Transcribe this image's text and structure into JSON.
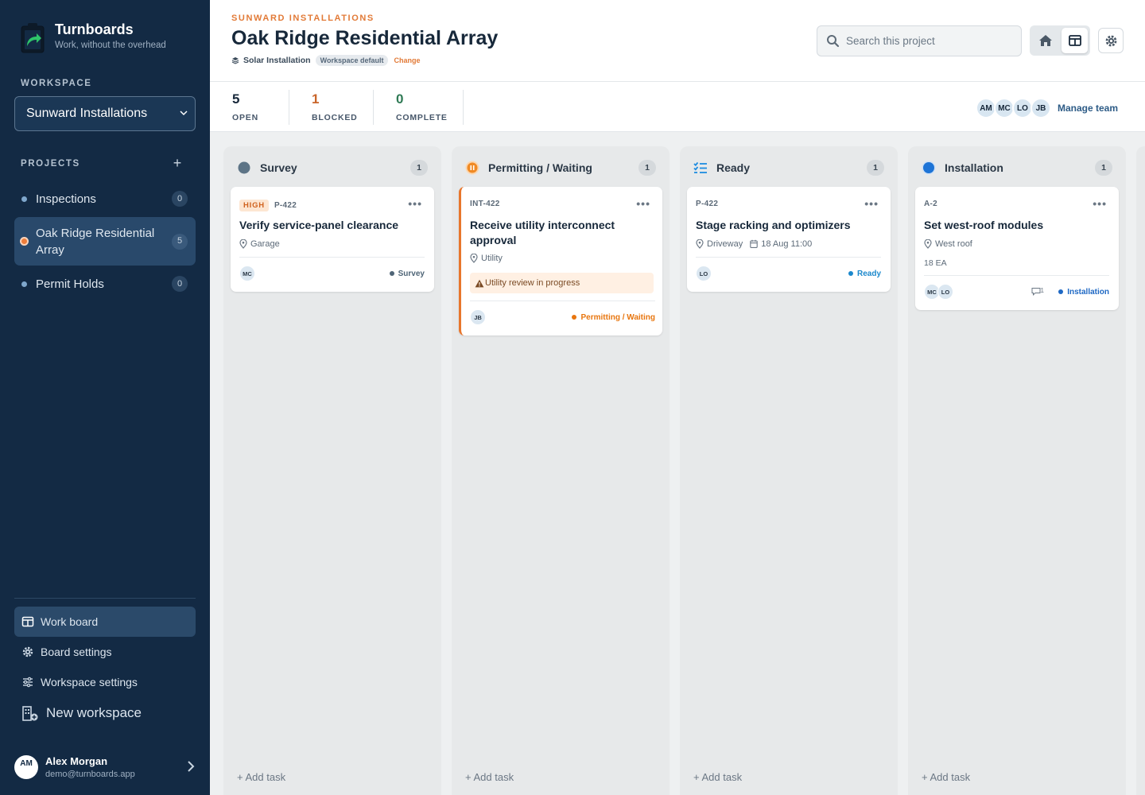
{
  "brand": {
    "name": "Turnboards",
    "tagline": "Work, without the overhead"
  },
  "sidebar": {
    "workspace_label": "WORKSPACE",
    "workspace_selected": "Sunward Installations",
    "projects_label": "PROJECTS",
    "add_project": "+",
    "projects": [
      {
        "name": "Inspections",
        "count": "0"
      },
      {
        "name": "Oak Ridge Residential Array",
        "count": "5"
      },
      {
        "name": "Permit Holds",
        "count": "0"
      }
    ],
    "nav": [
      {
        "label": "Work board"
      },
      {
        "label": "Board settings"
      },
      {
        "label": "Workspace settings"
      },
      {
        "label": "New workspace"
      }
    ],
    "user": {
      "initials": "AM",
      "name": "Alex Morgan",
      "email": "demo@turnboards.app"
    }
  },
  "header": {
    "org": "SUNWARD INSTALLATIONS",
    "title": "Oak Ridge Residential Array",
    "project_type": "Solar Installation",
    "type_chip": "Workspace default",
    "change": "Change",
    "search_placeholder": "Search this project"
  },
  "stats": [
    {
      "value": "5",
      "label": "OPEN",
      "color": "#17283a"
    },
    {
      "value": "1",
      "label": "BLOCKED",
      "color": "#c9652a"
    },
    {
      "value": "0",
      "label": "COMPLETE",
      "color": "#2f7a55"
    }
  ],
  "team": {
    "members": [
      "AM",
      "MC",
      "LO",
      "JB"
    ],
    "manage": "Manage team"
  },
  "columns": [
    {
      "title": "Survey",
      "count": "1",
      "icon": "circle-icon",
      "color": "#5d7486",
      "add_task": "+ Add task",
      "card": {
        "priority": "HIGH",
        "id": "P-422",
        "menu": "•••",
        "title": "Verify service-panel clearance",
        "location": "Garage",
        "assignees": [
          "MC"
        ],
        "status": "Survey",
        "status_color": "#4f6577"
      }
    },
    {
      "title": "Permitting / Waiting",
      "count": "1",
      "icon": "pause-icon",
      "color": "#f08a24",
      "add_task": "+ Add task",
      "card": {
        "id": "INT-422",
        "menu": "•••",
        "title": "Receive utility interconnect approval",
        "location": "Utility",
        "warning": "Utility review in progress",
        "assignees": [
          "JB"
        ],
        "status": "Permitting / Waiting",
        "status_color": "#e8760f"
      }
    },
    {
      "title": "Ready",
      "count": "1",
      "icon": "checklist-icon",
      "color": "#1f8ce0",
      "add_task": "+ Add task",
      "card": {
        "id": "P-422",
        "menu": "•••",
        "title": "Stage racking and optimizers",
        "location": "Driveway",
        "date": "18 Aug 11:00",
        "assignees": [
          "LO"
        ],
        "status": "Ready",
        "status_color": "#1b88cc"
      }
    },
    {
      "title": "Installation",
      "count": "1",
      "icon": "circle-icon",
      "color": "#1e74d6",
      "add_task": "+ Add task",
      "card": {
        "id": "A-2",
        "menu": "•••",
        "title": "Set west-roof modules",
        "location": "West roof",
        "quantity": "18 EA",
        "assignees": [
          "MC",
          "LO"
        ],
        "comments": "1",
        "status": "Installation",
        "status_color": "#1e68c4"
      }
    }
  ]
}
